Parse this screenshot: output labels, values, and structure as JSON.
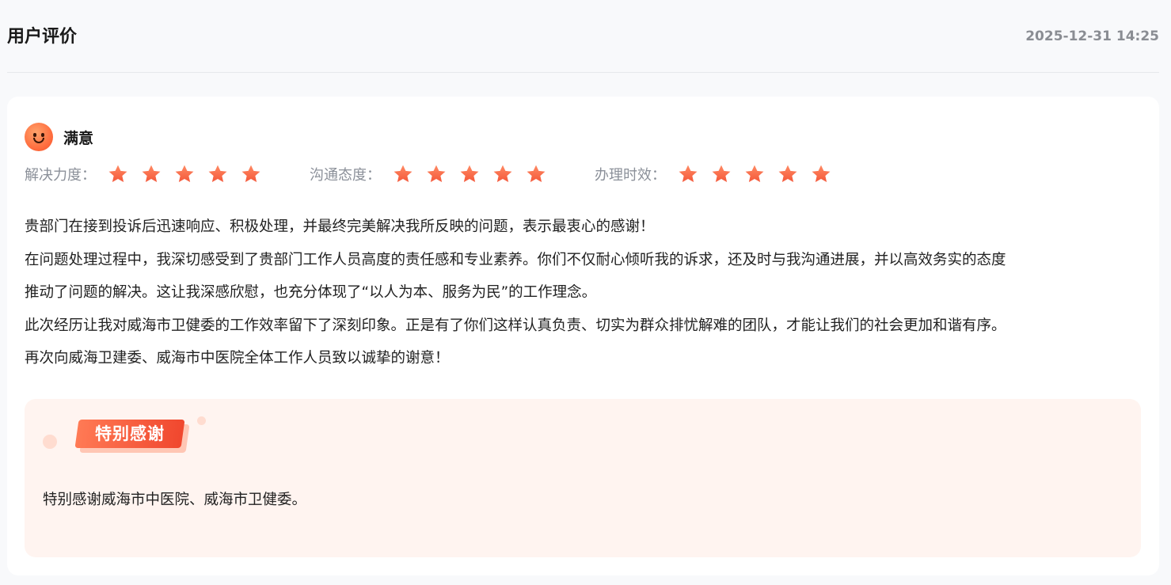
{
  "header": {
    "title": "用户评价",
    "timestamp": "2025-12-31 14:25"
  },
  "rating": {
    "face_icon": "smile-face-icon",
    "satisfaction": "满意",
    "accent_color": "#f4583a",
    "scores": [
      {
        "label": "解决力度：",
        "stars": 5,
        "max": 5
      },
      {
        "label": "沟通态度：",
        "stars": 5,
        "max": 5
      },
      {
        "label": "办理时效：",
        "stars": 5,
        "max": 5
      }
    ]
  },
  "comment": {
    "lines": [
      "贵部门在接到投诉后迅速响应、积极处理，并最终完美解决我所反映的问题，表示最衷心的感谢！",
      "在问题处理过程中，我深切感受到了贵部门工作人员高度的责任感和专业素养。你们不仅耐心倾听我的诉求，还及时与我沟通进展，并以高效务实的态度",
      "推动了问题的解决。这让我深感欣慰，也充分体现了“以人为本、服务为民”的工作理念。",
      "此次经历让我对威海市卫健委的工作效率留下了深刻印象。正是有了你们这样认真负责、切实为群众排忧解难的团队，才能让我们的社会更加和谐有序。",
      "再次向威海卫建委、威海市中医院全体工作人员致以诚挚的谢意！"
    ]
  },
  "special_thanks": {
    "badge": "特别感谢",
    "text": "特别感谢威海市中医院、威海市卫健委。"
  }
}
